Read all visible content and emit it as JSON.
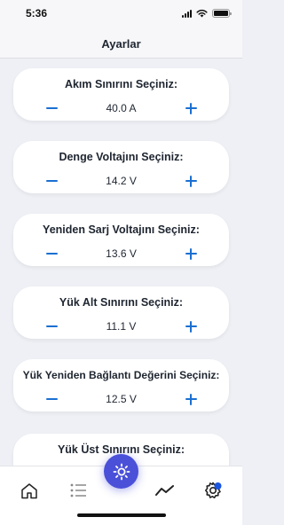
{
  "status_bar": {
    "time": "5:36"
  },
  "header": {
    "title": "Ayarlar"
  },
  "settings": [
    {
      "title": "Akım Sınırını Seçiniz:",
      "value": "40.0 A"
    },
    {
      "title": "Denge Voltajını Seçiniz:",
      "value": "14.2 V"
    },
    {
      "title": "Yeniden Sarj Voltajını Seçiniz:",
      "value": "13.6 V"
    },
    {
      "title": "Yük Alt Sınırını Seçiniz:",
      "value": "11.1 V"
    },
    {
      "title": "Yük Yeniden Bağlantı Değerini Seçiniz:",
      "value": "12.5 V"
    },
    {
      "title": "Yük Üst Sınırını Seçiniz:",
      "value": ""
    }
  ],
  "tab_bar": {
    "tabs": [
      {
        "icon": "home-icon"
      },
      {
        "icon": "list-icon"
      },
      {
        "icon": "brightness-icon"
      },
      {
        "icon": "trend-icon"
      },
      {
        "icon": "settings-gear-icon"
      }
    ],
    "active": "settings-gear-icon"
  },
  "colors": {
    "accent": "#1a6fd1",
    "fab": "#4a50d8",
    "background": "#eef0f5",
    "card": "#ffffff",
    "text": "#1e2530"
  }
}
